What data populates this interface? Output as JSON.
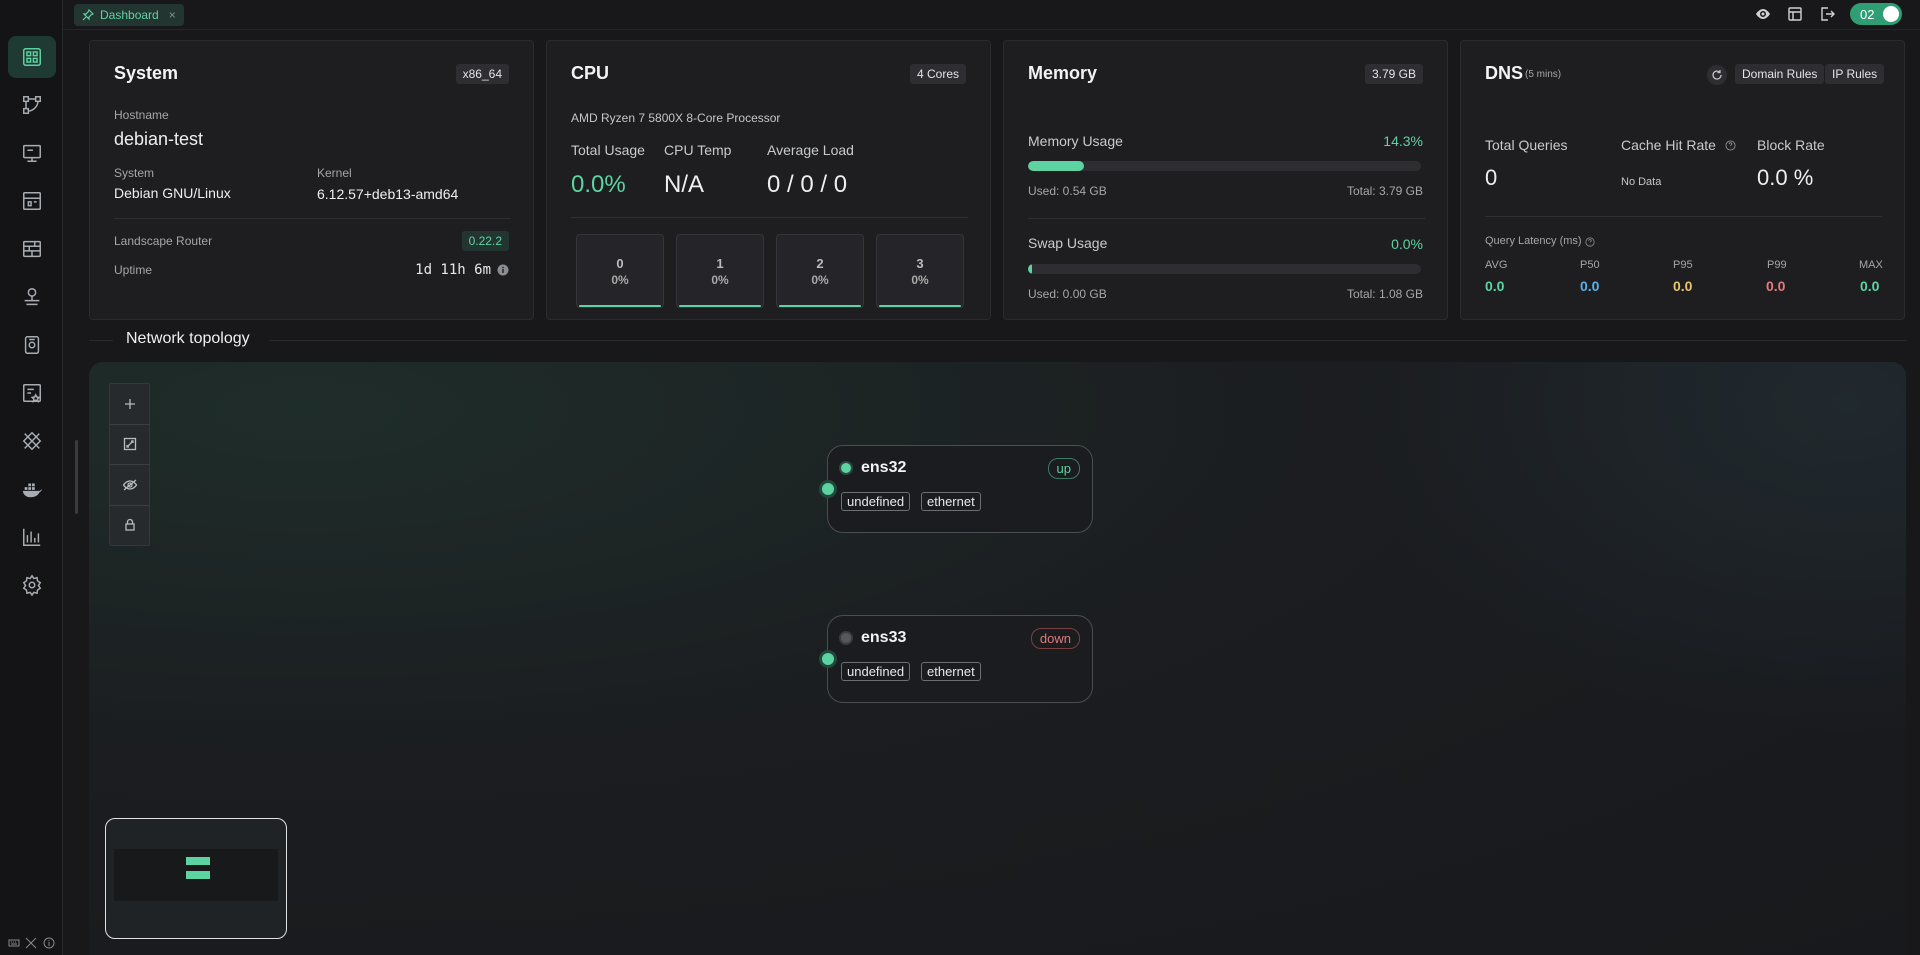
{
  "topbar": {
    "tab_label": "Dashboard",
    "tab_close": "×",
    "toggle_label": "02"
  },
  "system": {
    "title": "System",
    "arch_badge": "x86_64",
    "hostname_label": "Hostname",
    "hostname": "debian-test",
    "os_label": "System",
    "os": "Debian GNU/Linux",
    "kernel_label": "Kernel",
    "kernel": "6.12.57+deb13-amd64",
    "router_label": "Landscape Router",
    "router_version": "0.22.2",
    "uptime_label": "Uptime",
    "uptime": "1d 11h 6m"
  },
  "cpu": {
    "title": "CPU",
    "cores_badge": "4 Cores",
    "model": "AMD Ryzen 7 5800X 8-Core Processor",
    "total_usage_label": "Total Usage",
    "total_usage": "0.0%",
    "temp_label": "CPU Temp",
    "temp": "N/A",
    "load_label": "Average Load",
    "load": "0 / 0 / 0",
    "cores": [
      {
        "index": "0",
        "usage": "0%"
      },
      {
        "index": "1",
        "usage": "0%"
      },
      {
        "index": "2",
        "usage": "0%"
      },
      {
        "index": "3",
        "usage": "0%"
      }
    ]
  },
  "memory": {
    "title": "Memory",
    "total_badge": "3.79 GB",
    "mem_label": "Memory Usage",
    "mem_percent": "14.3%",
    "mem_fraction": 0.143,
    "mem_used": "Used: 0.54 GB",
    "mem_total": "Total: 3.79 GB",
    "swap_label": "Swap Usage",
    "swap_percent": "0.0%",
    "swap_fraction": 0.0,
    "swap_used": "Used: 0.00 GB",
    "swap_total": "Total: 1.08 GB"
  },
  "dns": {
    "title": "DNS",
    "window": "(5 mins)",
    "domain_rules": "Domain Rules",
    "ip_rules": "IP Rules",
    "total_queries_label": "Total Queries",
    "total_queries": "0",
    "cache_hit_label": "Cache Hit Rate",
    "cache_hit_value": "No Data",
    "block_rate_label": "Block Rate",
    "block_rate": "0.0 %",
    "latency_label": "Query Latency (ms)",
    "latency": [
      {
        "name": "AVG",
        "value": "0.0",
        "color": "#5ed3a2"
      },
      {
        "name": "P50",
        "value": "0.0",
        "color": "#5ab0e8"
      },
      {
        "name": "P95",
        "value": "0.0",
        "color": "#e8c46a"
      },
      {
        "name": "P99",
        "value": "0.0",
        "color": "#e57a7a"
      },
      {
        "name": "MAX",
        "value": "0.0",
        "color": "#5ed3a2"
      }
    ]
  },
  "topology": {
    "title": "Network topology",
    "nodes": [
      {
        "name": "ens32",
        "state": "up",
        "tags": [
          "undefined",
          "ethernet"
        ]
      },
      {
        "name": "ens33",
        "state": "down",
        "tags": [
          "undefined",
          "ethernet"
        ]
      }
    ]
  },
  "colors": {
    "accent": "#5ed3a2",
    "background": "#18181b",
    "card": "#1e1e21",
    "down": "#e07a7a"
  }
}
